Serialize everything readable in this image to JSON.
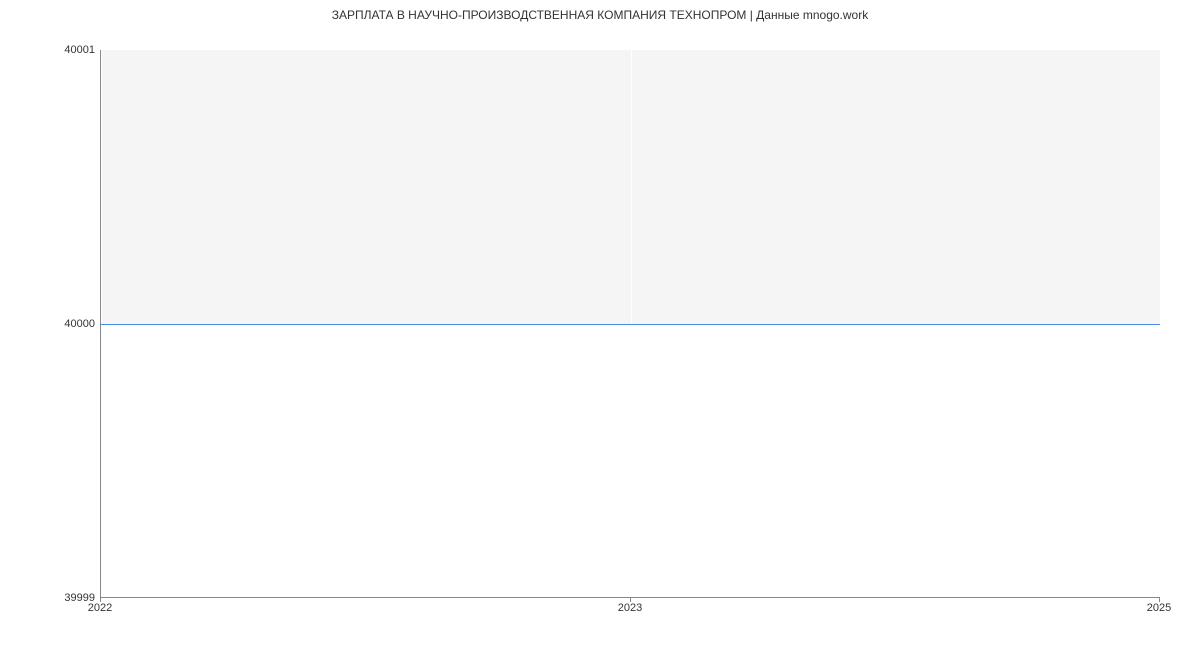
{
  "chart_data": {
    "type": "area",
    "title": "ЗАРПЛАТА В  НАУЧНО-ПРОИЗВОДСТВЕННАЯ КОМПАНИЯ ТЕХНОПРОМ | Данные mnogo.work",
    "x": [
      2022,
      2023,
      2025
    ],
    "values": [
      40000,
      40000,
      40000
    ],
    "xlabel": "",
    "ylabel": "",
    "x_ticks": [
      "2022",
      "2023",
      "2025"
    ],
    "y_ticks": [
      "39999",
      "40000",
      "40001"
    ],
    "ylim": [
      39999,
      40001
    ],
    "xlim": [
      2022,
      2025
    ],
    "line_color": "#4a90e2",
    "fill_color": "#ffffff"
  }
}
